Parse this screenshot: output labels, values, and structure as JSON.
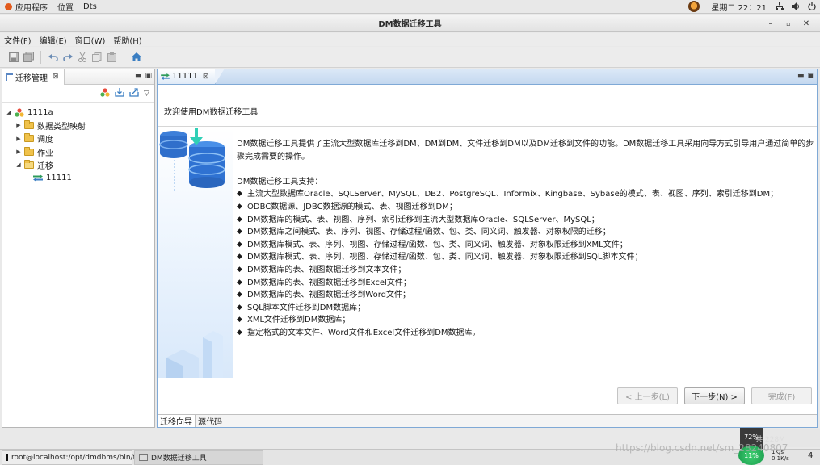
{
  "topbar": {
    "apps": "应用程序",
    "places": "位置",
    "current_app": "Dts",
    "clock": "星期二 22：21"
  },
  "window": {
    "title": "DM数据迁移工具"
  },
  "menu": [
    "文件(F)",
    "编辑(E)",
    "窗口(W)",
    "帮助(H)"
  ],
  "left_panel": {
    "tab_label": "迁移管理",
    "tree": [
      {
        "label": "1111a",
        "level": 0,
        "expanded": true,
        "type": "project"
      },
      {
        "label": "数据类型映射",
        "level": 1,
        "expanded": false,
        "type": "folder"
      },
      {
        "label": "调度",
        "level": 1,
        "expanded": false,
        "type": "folder"
      },
      {
        "label": "作业",
        "level": 1,
        "expanded": false,
        "type": "folder"
      },
      {
        "label": "迁移",
        "level": 1,
        "expanded": true,
        "type": "folder"
      },
      {
        "label": "11111",
        "level": 2,
        "expanded": false,
        "type": "migration"
      }
    ]
  },
  "editor": {
    "tab_label": "11111",
    "welcome": "欢迎使用DM数据迁移工具",
    "intro": "DM数据迁移工具提供了主流大型数据库迁移到DM、DM到DM、文件迁移到DM以及DM迁移到文件的功能。DM数据迁移工具采用向导方式引导用户通过简单的步骤完成需要的操作。",
    "support_title": "DM数据迁移工具支持：",
    "bullet": "◆",
    "features": [
      "主流大型数据库Oracle、SQLServer、MySQL、DB2、PostgreSQL、Informix、Kingbase、Sybase的模式、表、视图、序列、索引迁移到DM；",
      "ODBC数据源、JDBC数据源的模式、表、视图迁移到DM；",
      "DM数据库的模式、表、视图、序列、索引迁移到主流大型数据库Oracle、SQLServer、MySQL；",
      "DM数据库之间模式、表、序列、视图、存储过程/函数、包、类、同义词、触发器、对象权限的迁移；",
      "DM数据库模式、表、序列、视图、存储过程/函数、包、类、同义词、触发器、对象权限迁移到XML文件；",
      "DM数据库模式、表、序列、视图、存储过程/函数、包、类、同义词、触发器、对象权限迁移到SQL脚本文件；",
      "DM数据库的表、视图数据迁移到文本文件；",
      "DM数据库的表、视图数据迁移到Excel文件；",
      "DM数据库的表、视图数据迁移到Word文件；",
      "SQL脚本文件迁移到DM数据库；",
      "XML文件迁移到DM数据库；",
      "指定格式的文本文件、Word文件和Excel文件迁移到DM数据库。"
    ],
    "buttons": {
      "back": "< 上一步(L)",
      "next": "下一步(N) >",
      "finish": "完成(F)"
    },
    "bottom_tabs": [
      "迁移向导",
      "源代码"
    ]
  },
  "status": {
    "net_rate": "72%",
    "mem": "共 228M",
    "speed": "11%",
    "kbs_up": "1K/s",
    "kbs_down": "0.1K/s",
    "page": "4"
  },
  "taskbar": {
    "terminal": "root@localhost:/opt/dmdbms/bin/t···",
    "app": "DM数据迁移工具"
  },
  "watermark": "https://blog.csdn.net/sm_28240807"
}
